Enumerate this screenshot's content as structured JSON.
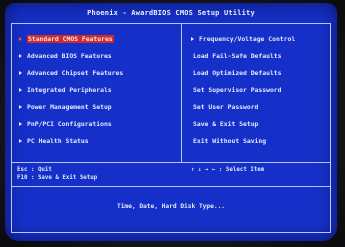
{
  "title": "Phoenix - AwardBIOS CMOS Setup Utility",
  "left_menu": [
    {
      "label": "Standard CMOS Features",
      "selected": true
    },
    {
      "label": "Advanced BIOS Features"
    },
    {
      "label": "Advanced Chipset Features"
    },
    {
      "label": "Integrated Peripherals"
    },
    {
      "label": "Power Management Setup"
    },
    {
      "label": "PnP/PCI Configurations"
    },
    {
      "label": "PC Health Status"
    }
  ],
  "right_menu": [
    {
      "label": "Frequency/Voltage Control",
      "arrow": true
    },
    {
      "label": "Load Fail-Safe Defaults"
    },
    {
      "label": "Load Optimized Defaults"
    },
    {
      "label": "Set Supervisor Password"
    },
    {
      "label": "Set User Password"
    },
    {
      "label": "Save & Exit Setup"
    },
    {
      "label": "Exit Without Saving"
    }
  ],
  "help": {
    "esc": "Esc : Quit",
    "f10": "F10 : Save & Exit Setup",
    "nav": "↑ ↓ → ←   : Select Item"
  },
  "description": "Time, Date, Hard Disk Type...",
  "colors": {
    "background": "#1530c8",
    "text": "#e4e9ff",
    "selected": "#ff4b3a"
  }
}
